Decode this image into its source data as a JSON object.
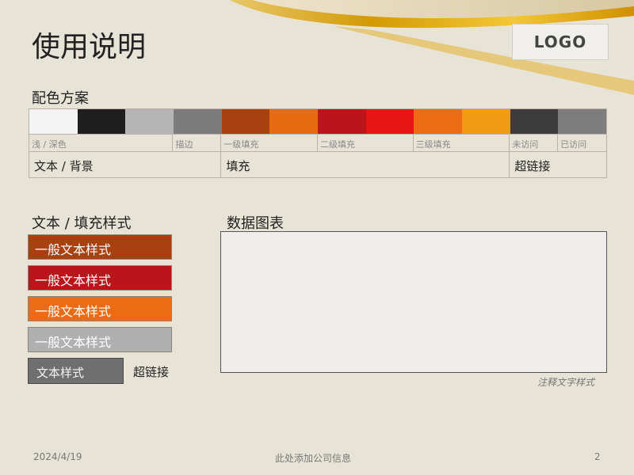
{
  "slide": {
    "title": "使用说明",
    "logo": "LOGO",
    "colors": {
      "background": "#e8e3d7",
      "accent_gold": "#d9a300"
    }
  },
  "palette": {
    "label": "配色方案",
    "swatches": [
      "#f4f4f4",
      "#1e1e1e",
      "#b5b5b5",
      "#7b7b7b",
      "#a8400f",
      "#e76b10",
      "#b9151a",
      "#e81515",
      "#ec6b14",
      "#f39a14",
      "#3c3c3c",
      "#7d7d7d"
    ],
    "sub_labels": [
      "浅 / 深色",
      "描边",
      "一级填充",
      "二级填充",
      "三级填充",
      "未访问",
      "已访问"
    ],
    "categories": [
      "文本 / 背景",
      "填充",
      "超链接"
    ]
  },
  "text_styles": {
    "label": "文本 / 填充样式",
    "items": [
      {
        "text": "一般文本样式",
        "color": "#a8400f"
      },
      {
        "text": "一般文本样式",
        "color": "#b9151a"
      },
      {
        "text": "一般文本样式",
        "color": "#ec6b14"
      },
      {
        "text": "一般文本样式",
        "color": "#b0b0b0"
      }
    ],
    "small_style": "文本样式",
    "hyperlink": "超链接"
  },
  "chart": {
    "label": "数据图表",
    "note": "注释文字样式"
  },
  "footer": {
    "date": "2024/4/19",
    "company": "此处添加公司信息",
    "page": "2"
  }
}
